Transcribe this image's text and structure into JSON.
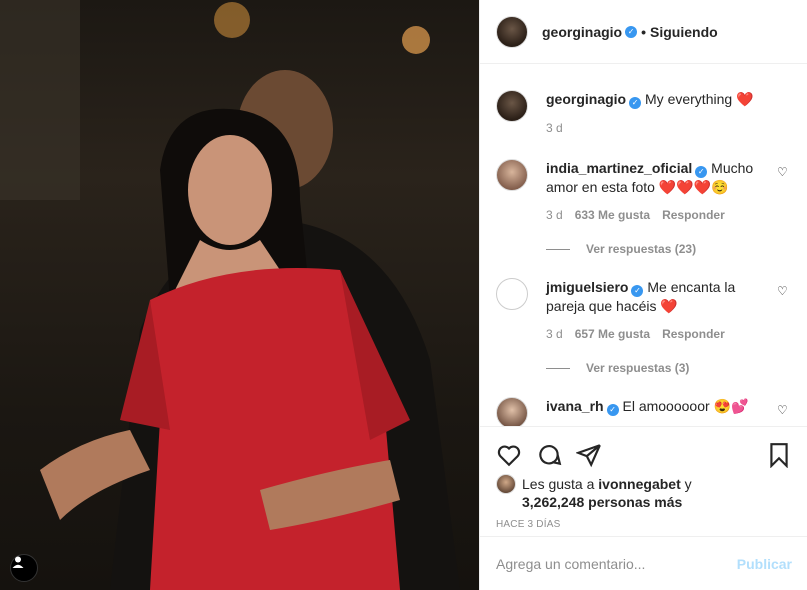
{
  "post": {
    "photo_alt": "",
    "author": "georginagio",
    "follow_status": "Siguiendo",
    "caption": "My everything ❤️",
    "caption_age": "3 d"
  },
  "comments": [
    {
      "user": "india_martinez_oficial",
      "text": "Mucho amor en esta foto ❤️❤️❤️☺️",
      "age": "3 d",
      "likes": "633 Me gusta",
      "reply": "Responder",
      "replies": "Ver respuestas (23)"
    },
    {
      "user": "jmiguelsiero",
      "text": "Me encanta la pareja que hacéis ❤️",
      "age": "3 d",
      "likes": "657 Me gusta",
      "reply": "Responder",
      "replies": "Ver respuestas (3)"
    },
    {
      "user": "ivana_rh",
      "text": "El amoooooor 😍💕"
    }
  ],
  "likes": {
    "prefix": "Les gusta a",
    "first_user": "ivonnegabet",
    "suffix": "y",
    "others": "3,262,248 personas más"
  },
  "date": "HACE 3 DÍAS",
  "add_comment": {
    "placeholder": "Agrega un comentario...",
    "publish": "Publicar"
  },
  "icons": {
    "like": "heart-icon",
    "comment": "comment-icon",
    "share": "paper-plane-icon",
    "save": "bookmark-icon",
    "tag": "user-tag-icon"
  },
  "colors": {
    "verified": "#3897f0",
    "publish_disabled": "#b2dffc",
    "muted": "#8e8e8e"
  }
}
